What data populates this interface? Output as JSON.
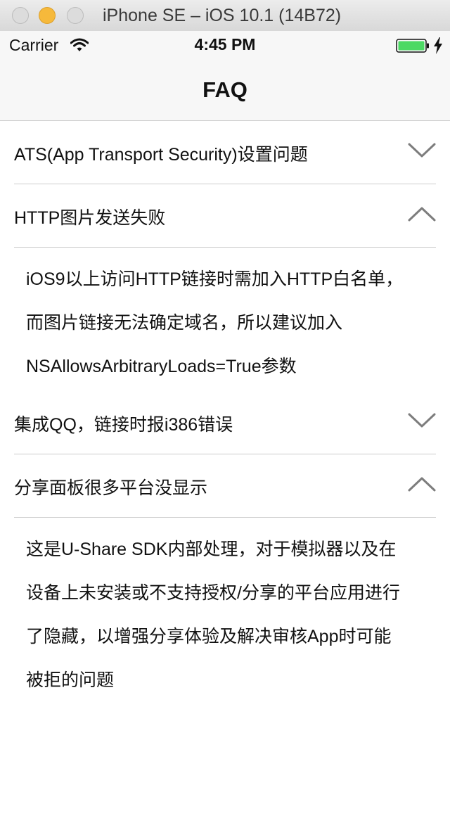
{
  "window": {
    "title": "iPhone SE – iOS 10.1 (14B72)"
  },
  "status_bar": {
    "carrier": "Carrier",
    "time": "4:45 PM",
    "battery_color": "#4cd964"
  },
  "nav": {
    "title": "FAQ"
  },
  "faq": [
    {
      "question": "ATS(App Transport Security)设置问题",
      "expanded": false,
      "answer_lines": []
    },
    {
      "question": "HTTP图片发送失败",
      "expanded": true,
      "answer_lines": [
        "iOS9以上访问HTTP链接时需加入HTTP白名单，",
        "而图片链接无法确定域名，所以建议加入",
        "NSAllowsArbitraryLoads=True参数"
      ]
    },
    {
      "question": "集成QQ，链接时报i386错误",
      "expanded": false,
      "answer_lines": []
    },
    {
      "question": "分享面板很多平台没显示",
      "expanded": true,
      "answer_lines": [
        "这是U-Share SDK内部处理，对于模拟器以及在",
        "设备上未安装或不支持授权/分享的平台应用进行",
        "了隐藏，以增强分享体验及解决审核App时可能",
        "被拒的问题"
      ]
    }
  ]
}
